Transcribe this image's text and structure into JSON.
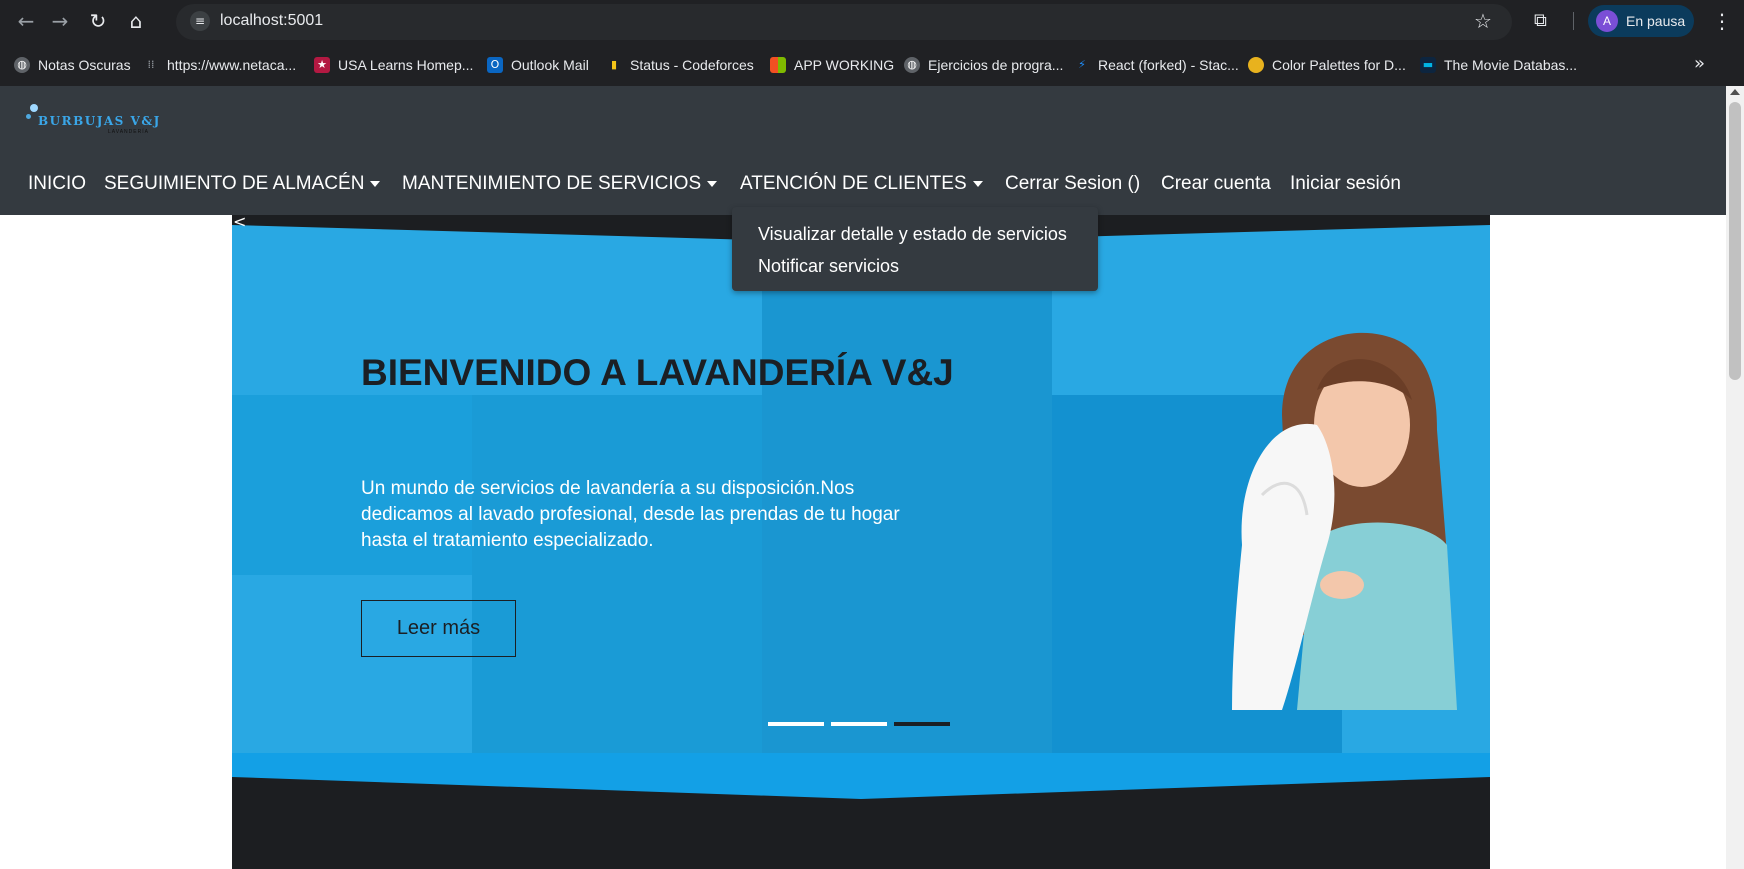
{
  "browser": {
    "url": "localhost:5001",
    "profile_initial": "A",
    "profile_status": "En pausa",
    "icons": [
      "back-icon",
      "forward-icon",
      "reload-icon",
      "home-icon",
      "tune-icon",
      "star-icon",
      "extensions-icon",
      "menu-icon"
    ],
    "bookmarks": [
      {
        "label": "Notas Oscuras",
        "icon": "globe-icon"
      },
      {
        "label": "https://www.netaca...",
        "icon": "cisco-icon"
      },
      {
        "label": "USA Learns Homep...",
        "icon": "star-badge-icon"
      },
      {
        "label": "Outlook Mail",
        "icon": "outlook-icon"
      },
      {
        "label": "Status - Codeforces",
        "icon": "codeforces-icon"
      },
      {
        "label": "APP WORKING",
        "icon": "microsoft-icon"
      },
      {
        "label": "Ejercicios de progra...",
        "icon": "globe-icon"
      },
      {
        "label": "React (forked) - Stac...",
        "icon": "bolt-icon"
      },
      {
        "label": "Color Palettes for D...",
        "icon": "palette-icon"
      },
      {
        "label": "The Movie Databas...",
        "icon": "tmdb-icon"
      }
    ],
    "more": "»"
  },
  "site": {
    "logo": {
      "main": "BURBUJAS V&J",
      "sub": "LAVANDERÍA"
    },
    "nav": {
      "inicio": "INICIO",
      "almacen": "SEGUIMIENTO DE ALMACÉN",
      "mantenimiento": "MANTENIMIENTO DE SERVICIOS",
      "atencion": "ATENCIÓN DE CLIENTES",
      "cerrar": "Cerrar Sesion ()",
      "crear": "Crear cuenta",
      "iniciar": "Iniciar sesión"
    },
    "dropdown": [
      "Visualizar detalle y estado de servicios",
      "Notificar servicios"
    ],
    "hero": {
      "title": "BIENVENIDO A LAVANDERÍA V&J",
      "text": "Un mundo de servicios de lavandería a su disposición.Nos dedicamos al lavado profesional, desde las prendas de tu hogar hasta el tratamiento especializado.",
      "button": "Leer más",
      "prev": "<",
      "slides_total": 3,
      "active_slide": 3
    },
    "colors": {
      "header": "#343a40",
      "hero_blue": "#29a8e3",
      "hero_dark": "#1c1e21",
      "dropdown": "#343a40"
    }
  }
}
